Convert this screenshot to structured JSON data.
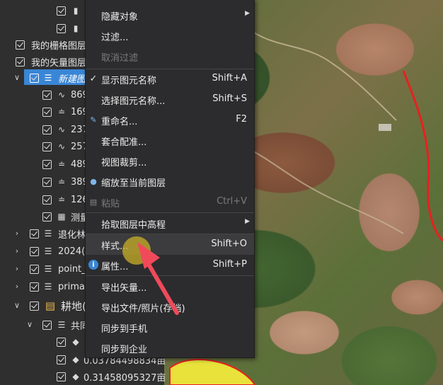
{
  "tree": {
    "rows": [
      {
        "label": "",
        "icon": "book-icon"
      },
      {
        "label": "",
        "icon": "book-icon"
      },
      {
        "label": "我的栅格图层("
      },
      {
        "label": "我的矢量图层("
      },
      {
        "label": "新建图"
      },
      {
        "label": "869",
        "icon": "polyline-icon"
      },
      {
        "label": "169",
        "icon": "ruler-icon"
      },
      {
        "label": "237",
        "icon": "polyline-icon"
      },
      {
        "label": "257",
        "icon": "polyline-icon"
      },
      {
        "label": "489",
        "icon": "ruler-icon"
      },
      {
        "label": "389",
        "icon": "ruler-icon"
      },
      {
        "label": "126",
        "icon": "ruler-icon"
      },
      {
        "label": "测量",
        "icon": "measure-icon"
      },
      {
        "label": "退化林"
      },
      {
        "label": "2024(2"
      },
      {
        "label": "point_("
      },
      {
        "label": "primar"
      },
      {
        "label": "耕地("
      },
      {
        "label": "共同"
      },
      {
        "label": ""
      },
      {
        "label": "0.03784498834亩"
      },
      {
        "label": "0.31458095327亩"
      }
    ]
  },
  "menu": {
    "items": [
      {
        "label": "隐藏对象",
        "shortcut": "",
        "submenu": true
      },
      {
        "label": "过滤...",
        "shortcut": ""
      },
      {
        "label": "取消过滤",
        "shortcut": "",
        "disabled": true
      },
      {
        "label": "显示图元名称",
        "shortcut": "Shift+A",
        "checked": true
      },
      {
        "label": "选择图元名称...",
        "shortcut": "Shift+S"
      },
      {
        "label": "重命名...",
        "shortcut": "F2"
      },
      {
        "label": "套合配准...",
        "shortcut": ""
      },
      {
        "label": "视图裁剪...",
        "shortcut": ""
      },
      {
        "label": "缩放至当前图层",
        "shortcut": ""
      },
      {
        "label": "粘贴",
        "shortcut": "Ctrl+V",
        "disabled": true
      },
      {
        "label": "拾取图层中高程",
        "shortcut": "",
        "submenu": true
      },
      {
        "label": "样式...",
        "shortcut": "Shift+O"
      },
      {
        "label": "属性...",
        "shortcut": "Shift+P"
      },
      {
        "label": "导出矢量...",
        "shortcut": ""
      },
      {
        "label": "导出文件/照片(存档)",
        "shortcut": ""
      },
      {
        "label": "同步到手机",
        "shortcut": ""
      },
      {
        "label": "同步到企业",
        "shortcut": ""
      }
    ]
  },
  "colors": {
    "selection": "#3a86d6",
    "annotation_arrow": "#f04a5a",
    "boundary_line": "#e82020",
    "field_polygon": "#e9e23a"
  }
}
